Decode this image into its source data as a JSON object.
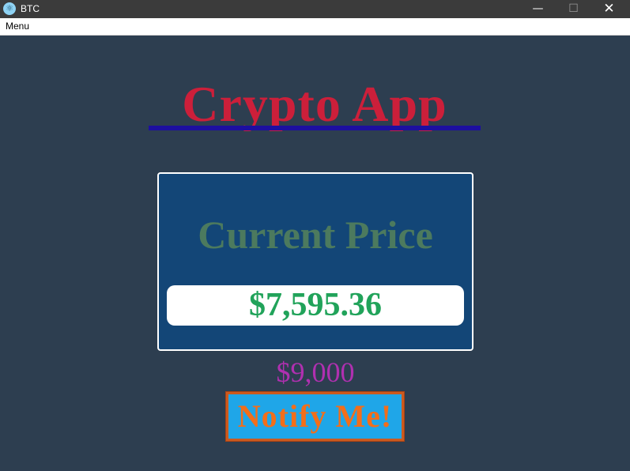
{
  "window": {
    "title": "BTC",
    "icon": "electron-atom-icon",
    "minimize_glyph": "—",
    "maximize_glyph": "☐",
    "close_glyph": "✕"
  },
  "menubar": {
    "items": [
      {
        "label": "Menu"
      }
    ]
  },
  "main": {
    "app_title": "Crypto App",
    "price_card": {
      "heading": "Current Price",
      "value": "$7,595.36"
    },
    "target_price": "$9,000",
    "notify_button": "Notify Me!"
  },
  "colors": {
    "background": "#2d3e50",
    "title": "#cc1f3a",
    "title_underline": "#1d0fa0",
    "card": "#134677",
    "heading": "#4c7a5e",
    "price": "#21a35a",
    "target": "#b030b0",
    "button_bg": "#1fa6e8",
    "button_text": "#f26e1a",
    "button_border": "#cc5a1f"
  }
}
